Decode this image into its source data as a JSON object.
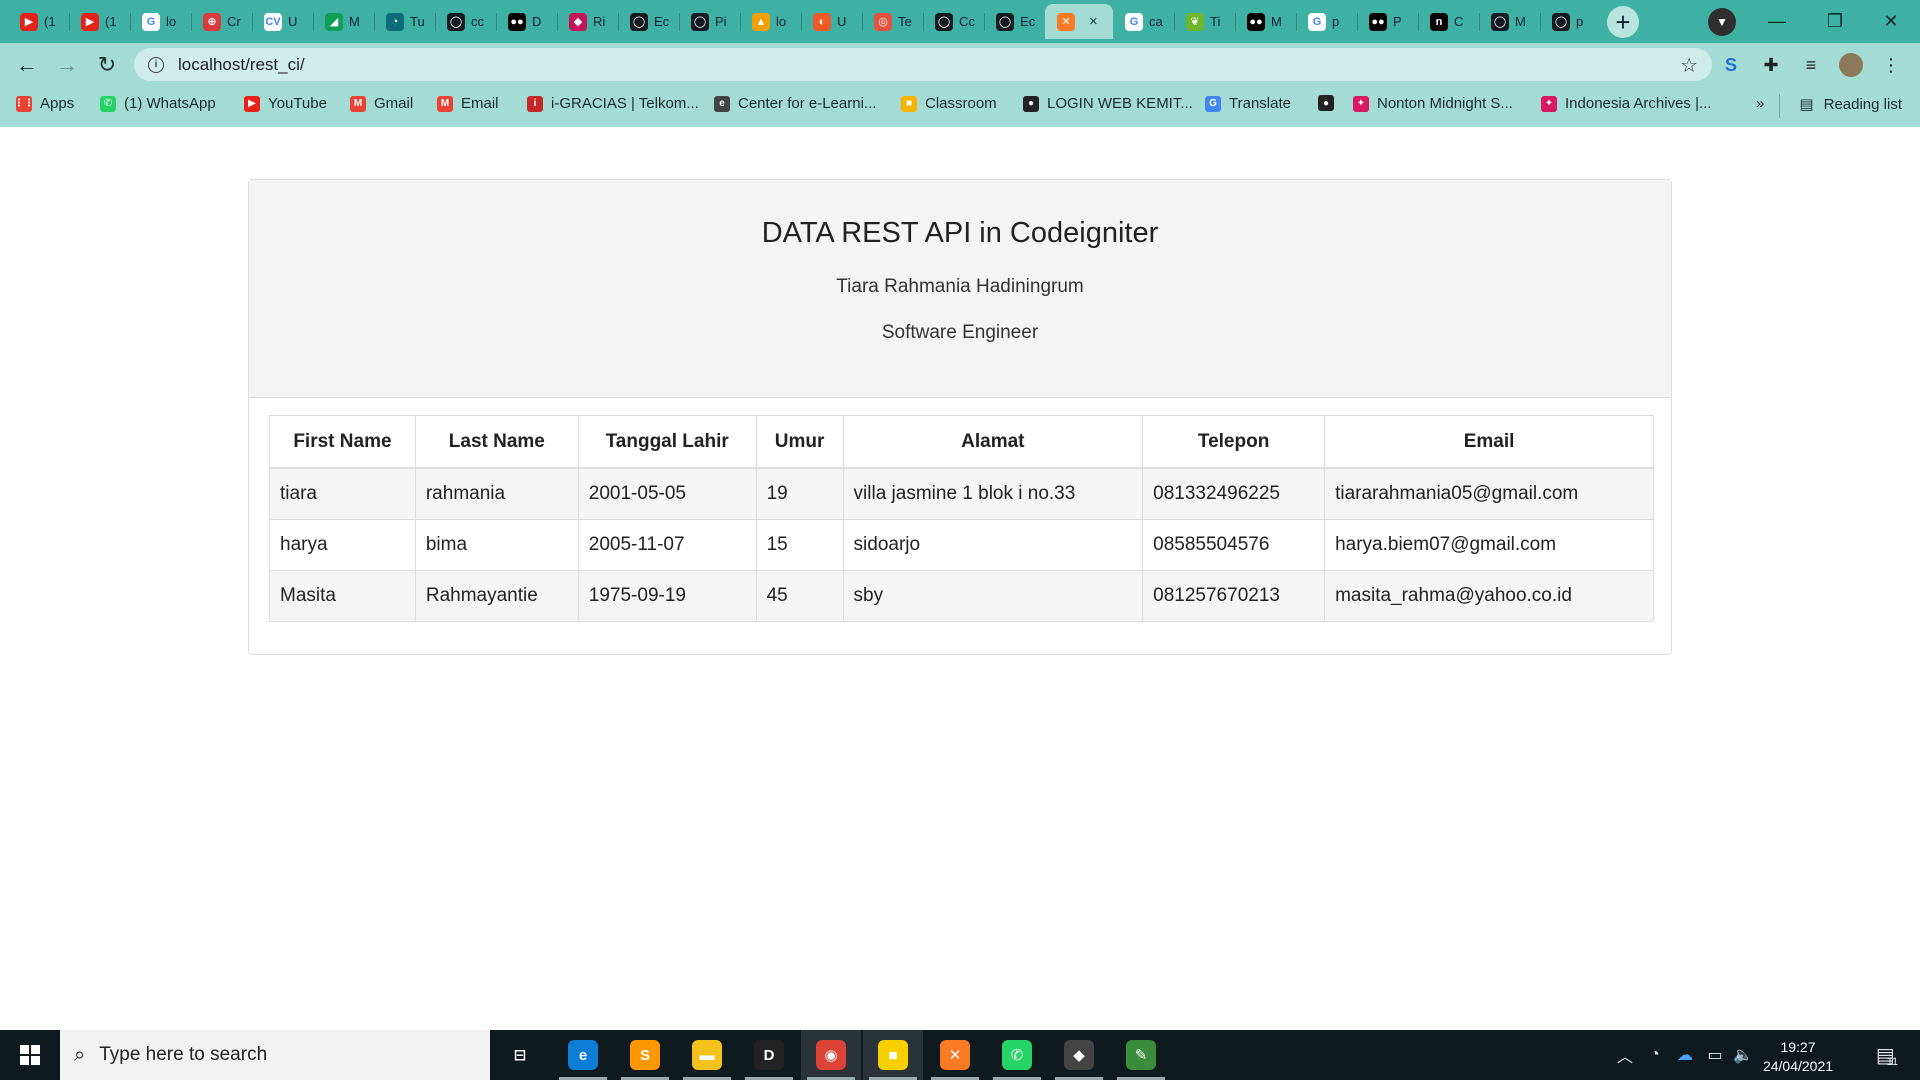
{
  "browser": {
    "tabs": [
      {
        "title": "(1",
        "color": "#e62117",
        "glyph": "▶"
      },
      {
        "title": "(1",
        "color": "#e62117",
        "glyph": "▶"
      },
      {
        "title": "lo",
        "color": "#ffffff",
        "glyph": "G"
      },
      {
        "title": "Cr",
        "color": "#d93a3a",
        "glyph": "⊕"
      },
      {
        "title": "U",
        "color": "#ffffff",
        "glyph": "CV"
      },
      {
        "title": "M",
        "color": "#0f9d58",
        "glyph": "◢"
      },
      {
        "title": "Tu",
        "color": "#0a6b79",
        "glyph": "◔"
      },
      {
        "title": "cc",
        "color": "#161b22",
        "glyph": "◯"
      },
      {
        "title": "D",
        "color": "#000000",
        "glyph": "●●"
      },
      {
        "title": "Ri",
        "color": "#c2185b",
        "glyph": "◆"
      },
      {
        "title": "Ec",
        "color": "#161b22",
        "glyph": "◯"
      },
      {
        "title": "Pi",
        "color": "#161b22",
        "glyph": "◯"
      },
      {
        "title": "lo",
        "color": "#f0a000",
        "glyph": "▲"
      },
      {
        "title": "U",
        "color": "#f05a28",
        "glyph": "◐"
      },
      {
        "title": "Te",
        "color": "#e5533d",
        "glyph": "◎"
      },
      {
        "title": "Cc",
        "color": "#161b22",
        "glyph": "◯"
      },
      {
        "title": "Ec",
        "color": "#161b22",
        "glyph": "◯"
      },
      {
        "title": "",
        "color": "#fb7a24",
        "glyph": "✕",
        "active": true,
        "close": "×"
      },
      {
        "title": "ca",
        "color": "#ffffff",
        "glyph": "G"
      },
      {
        "title": "Ti",
        "color": "#6cb52d",
        "glyph": "❦"
      },
      {
        "title": "M",
        "color": "#000000",
        "glyph": "●●"
      },
      {
        "title": "p",
        "color": "#ffffff",
        "glyph": "G"
      },
      {
        "title": "P",
        "color": "#000000",
        "glyph": "●●"
      },
      {
        "title": "C",
        "color": "#000000",
        "glyph": "n"
      },
      {
        "title": "M",
        "color": "#161b22",
        "glyph": "◯"
      },
      {
        "title": "p",
        "color": "#161b22",
        "glyph": "◯"
      }
    ],
    "new_tab": "+",
    "address": "localhost/rest_ci/",
    "window_controls": [
      "—",
      "❐",
      "✕"
    ]
  },
  "bookmarks": {
    "items": [
      {
        "label": "Apps",
        "color": "#e94235",
        "glyph": "⋮⋮"
      },
      {
        "label": "(1) WhatsApp",
        "color": "#25d366",
        "glyph": "✆"
      },
      {
        "label": "YouTube",
        "color": "#e62117",
        "glyph": "▶"
      },
      {
        "label": "Gmail",
        "color": "#ea4335",
        "glyph": "M"
      },
      {
        "label": "Email",
        "color": "#ea4335",
        "glyph": "M"
      },
      {
        "label": "i-GRACIAS | Telkom...",
        "color": "#c62828",
        "glyph": "i"
      },
      {
        "label": "Center for e-Learni...",
        "color": "#444444",
        "glyph": "e"
      },
      {
        "label": "Classroom",
        "color": "#f4b400",
        "glyph": "■"
      },
      {
        "label": "LOGIN WEB KEMIT...",
        "color": "#222222",
        "glyph": "●"
      },
      {
        "label": "Translate",
        "color": "#4285f4",
        "glyph": "G"
      },
      {
        "label": "",
        "color": "#222222",
        "glyph": "●"
      },
      {
        "label": "Nonton Midnight S...",
        "color": "#d81b60",
        "glyph": "✦"
      },
      {
        "label": "Indonesia Archives |...",
        "color": "#d81b60",
        "glyph": "✦"
      }
    ],
    "overflow": "»",
    "reading_list": "Reading list"
  },
  "page": {
    "title": "DATA REST API in Codeigniter",
    "author": "Tiara Rahmania Hadiningrum",
    "role": "Software Engineer",
    "columns": [
      "First Name",
      "Last Name",
      "Tanggal Lahir",
      "Umur",
      "Alamat",
      "Telepon",
      "Email"
    ],
    "rows": [
      [
        "tiara",
        "rahmania",
        "2001-05-05",
        "19",
        "villa jasmine 1 blok i no.33",
        "081332496225",
        "tiararahmania05@gmail.com"
      ],
      [
        "harya",
        "bima",
        "2005-11-07",
        "15",
        "sidoarjo",
        "08585504576",
        "harya.biem07@gmail.com"
      ],
      [
        "Masita",
        "Rahmayantie",
        "1975-09-19",
        "45",
        "sby",
        "081257670213",
        "masita_rahma@yahoo.co.id"
      ]
    ]
  },
  "taskbar": {
    "search_placeholder": "Type here to search",
    "apps": [
      {
        "name": "task-view",
        "glyph": "⊟",
        "color": "#0f1a1f"
      },
      {
        "name": "edge",
        "glyph": "e",
        "color": "#0c7cd5"
      },
      {
        "name": "sublime-text",
        "glyph": "S",
        "color": "#ff9800"
      },
      {
        "name": "file-explorer",
        "glyph": "▬",
        "color": "#f3c21b"
      },
      {
        "name": "dbeaver",
        "glyph": "D",
        "color": "#222222"
      },
      {
        "name": "chrome",
        "glyph": "◉",
        "color": "#db4437"
      },
      {
        "name": "sticky-notes",
        "glyph": "■",
        "color": "#f8d000"
      },
      {
        "name": "xampp",
        "glyph": "✕",
        "color": "#fb7a24"
      },
      {
        "name": "whatsapp",
        "glyph": "✆",
        "color": "#25d366"
      },
      {
        "name": "git",
        "glyph": "◆",
        "color": "#444444"
      },
      {
        "name": "notepad",
        "glyph": "✎",
        "color": "#3a8c3a"
      }
    ],
    "time": "19:27",
    "date": "24/04/2021",
    "notifications": "11"
  }
}
